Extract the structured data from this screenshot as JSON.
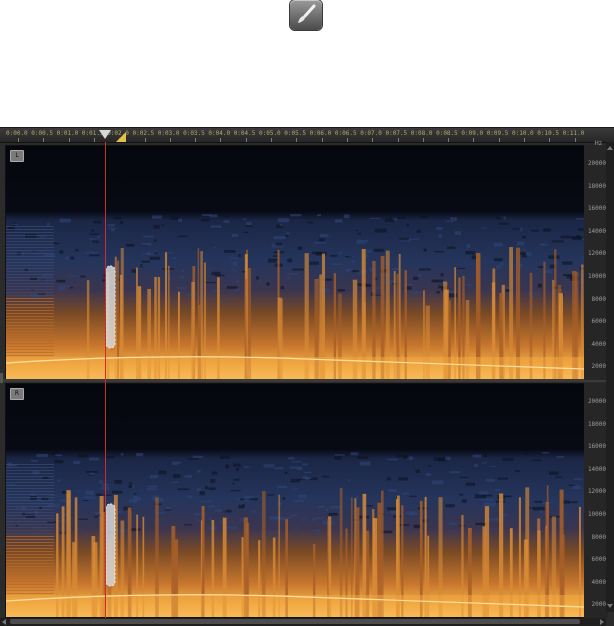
{
  "toolbar": {
    "brush_tool_icon": "paintbrush-icon"
  },
  "ruler": {
    "labels": [
      "0:00.0",
      "0:00.5",
      "0:01.0",
      "0:01.5",
      "0:02.0",
      "0:02.5",
      "0:03.0",
      "0:03.5",
      "0:04.0",
      "0:04.5",
      "0:05.0",
      "0:05.5",
      "0:06.0",
      "0:06.5",
      "0:07.0",
      "0:07.5",
      "0:08.0",
      "0:08.5",
      "0:09.0",
      "0:09.5",
      "0:10.0",
      "0:10.5",
      "0:11.0"
    ]
  },
  "channels": [
    {
      "id": "L",
      "label": "L"
    },
    {
      "id": "R",
      "label": "R"
    }
  ],
  "frequency_scale": {
    "unit": "Hz",
    "labels": [
      "20000",
      "18000",
      "16000",
      "14000",
      "12000",
      "10000",
      "8000",
      "6000",
      "4000",
      "2000"
    ]
  },
  "colors": {
    "background": "#2b2b2b",
    "playhead": "#d22b2b",
    "spectrogram_low": "#f5b04a",
    "spectrogram_mid": "#24365f",
    "spectrogram_high": "#05070d"
  }
}
